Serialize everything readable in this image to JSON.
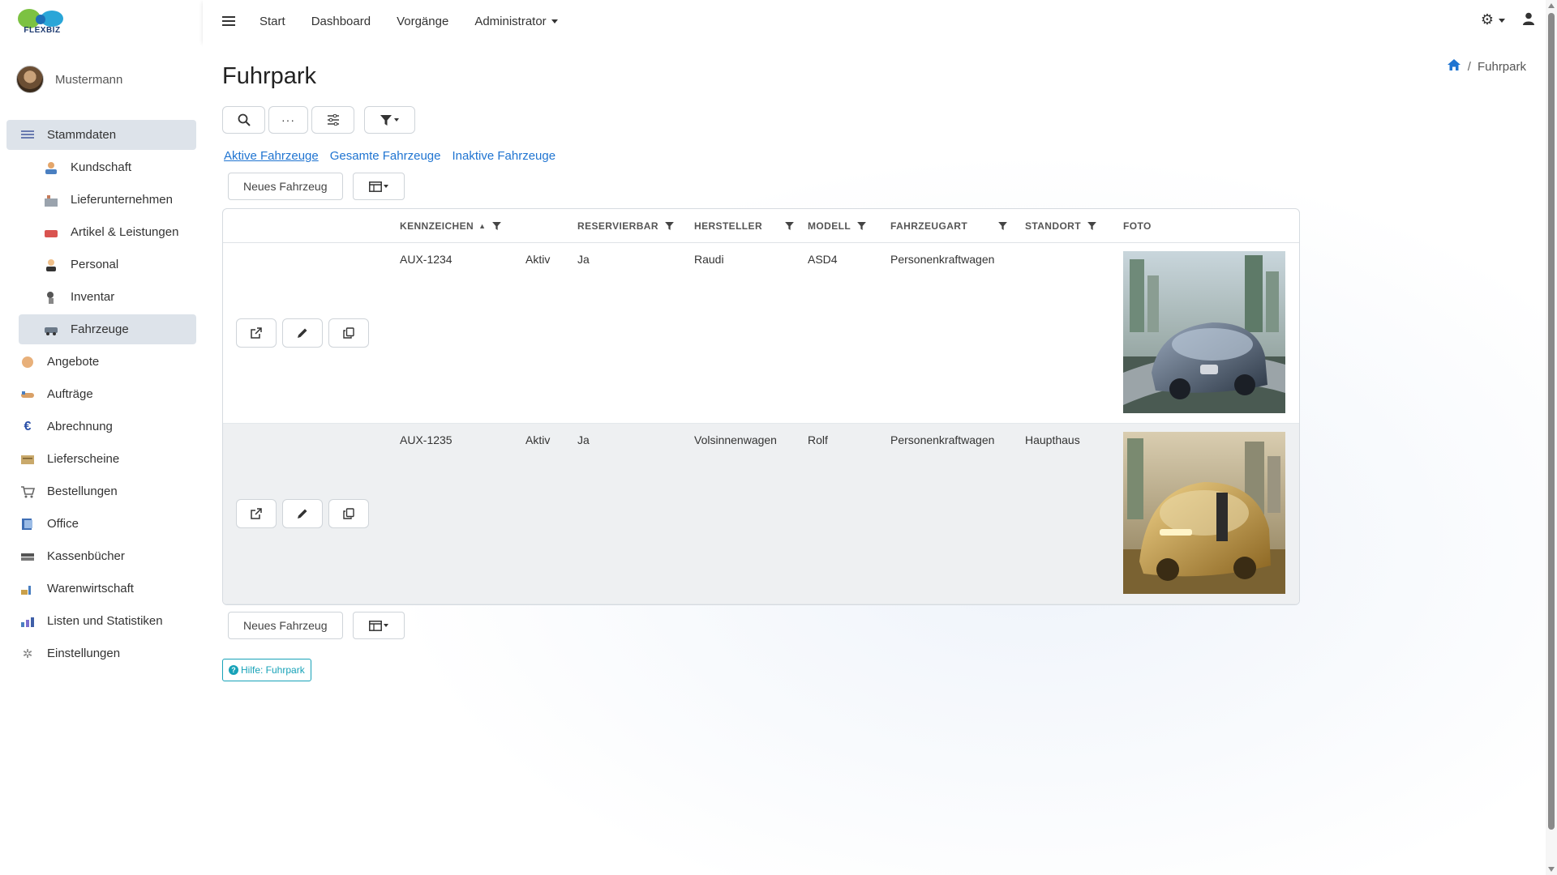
{
  "brand": {
    "name": "FLEXBIZ"
  },
  "user": {
    "name": "Mustermann"
  },
  "topnav": {
    "items": [
      "Start",
      "Dashboard",
      "Vorgänge",
      "Administrator"
    ]
  },
  "sidebar": {
    "items": [
      {
        "label": "Stammdaten",
        "icon": "list-icon",
        "active": true
      },
      {
        "label": "Kundschaft",
        "icon": "customer-icon",
        "sub": true
      },
      {
        "label": "Lieferunternehmen",
        "icon": "supplier-icon",
        "sub": true
      },
      {
        "label": "Artikel & Leistungen",
        "icon": "article-icon",
        "sub": true
      },
      {
        "label": "Personal",
        "icon": "staff-icon",
        "sub": true
      },
      {
        "label": "Inventar",
        "icon": "inventory-icon",
        "sub": true
      },
      {
        "label": "Fahrzeuge",
        "icon": "vehicle-icon",
        "sub": true,
        "active": true
      },
      {
        "label": "Angebote",
        "icon": "offer-icon"
      },
      {
        "label": "Aufträge",
        "icon": "handshake-icon"
      },
      {
        "label": "Abrechnung",
        "icon": "euro-icon"
      },
      {
        "label": "Lieferscheine",
        "icon": "delivery-note-icon"
      },
      {
        "label": "Bestellungen",
        "icon": "cart-icon"
      },
      {
        "label": "Office",
        "icon": "office-icon"
      },
      {
        "label": "Kassenbücher",
        "icon": "cashbook-icon"
      },
      {
        "label": "Warenwirtschaft",
        "icon": "warehouse-icon"
      },
      {
        "label": "Listen und Statistiken",
        "icon": "chart-icon"
      },
      {
        "label": "Einstellungen",
        "icon": "settings-icon"
      }
    ]
  },
  "page": {
    "title": "Fuhrpark",
    "breadcrumb": "Fuhrpark"
  },
  "filters": {
    "tabs": [
      "Aktive Fahrzeuge",
      "Gesamte Fahrzeuge",
      "Inaktive Fahrzeuge"
    ]
  },
  "actions": {
    "new_label": "Neues Fahrzeug"
  },
  "table": {
    "columns": [
      "KENNZEICHEN",
      "RESERVIERBAR",
      "HERSTELLER",
      "MODELL",
      "FAHRZEUGART",
      "STANDORT",
      "FOTO"
    ],
    "rows": [
      {
        "kennzeichen": "AUX-1234",
        "status": "Aktiv",
        "reservierbar": "Ja",
        "hersteller": "Raudi",
        "modell": "ASD4",
        "fahrzeugart": "Personenkraftwagen",
        "standort": ""
      },
      {
        "kennzeichen": "AUX-1235",
        "status": "Aktiv",
        "reservierbar": "Ja",
        "hersteller": "Volsinnenwagen",
        "modell": "Rolf",
        "fahrzeugart": "Personenkraftwagen",
        "standort": "Haupthaus"
      }
    ]
  },
  "help": {
    "label": "Hilfe: Fuhrpark"
  },
  "colors": {
    "link": "#1f74d1",
    "active_nav": "#dde3ea",
    "help": "#17a2b8"
  }
}
